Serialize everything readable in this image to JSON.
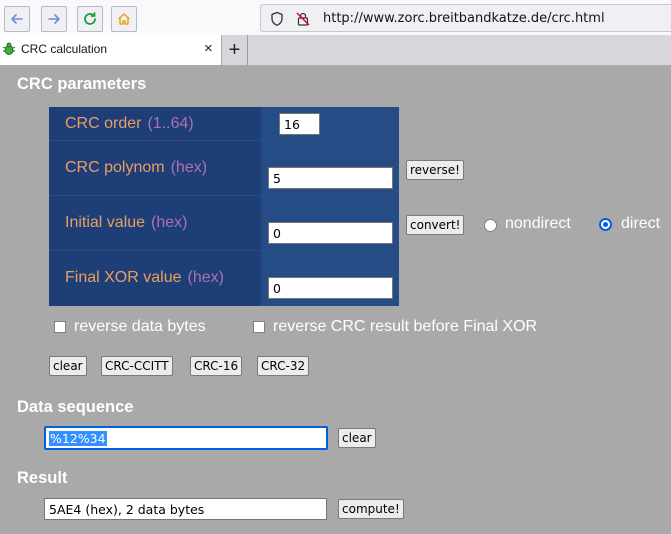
{
  "browser": {
    "url": "http://www.zorc.breitbandkatze.de/crc.html",
    "tab_title": "CRC calculation",
    "tab_close": "×",
    "new_tab": "+"
  },
  "params": {
    "heading": "CRC parameters",
    "rows": [
      {
        "label": "CRC order",
        "hint": "(1..64)",
        "value": "16"
      },
      {
        "label": "CRC polynom",
        "hint": "(hex)",
        "value": "5"
      },
      {
        "label": "Initial value",
        "hint": "(hex)",
        "value": "0"
      },
      {
        "label": "Final XOR value",
        "hint": "(hex)",
        "value": "0"
      }
    ],
    "reverse_button": "reverse!",
    "convert_button": "convert!",
    "radio_nondirect": "nondirect",
    "radio_direct": "direct",
    "selected_mode": "direct"
  },
  "options": {
    "reverse_data_bytes": "reverse data bytes",
    "reverse_crc_result": "reverse CRC result before Final XOR"
  },
  "presets": {
    "clear": "clear",
    "ccitt": "CRC-CCITT",
    "crc16": "CRC-16",
    "crc32": "CRC-32"
  },
  "data": {
    "heading": "Data sequence",
    "value": "%12%34",
    "clear": "clear"
  },
  "result": {
    "heading": "Result",
    "value": "5AE4 (hex), 2 data bytes",
    "compute": "compute!"
  },
  "colors": {
    "page_bg": "#a9a9a9",
    "table_label_bg": "#1e3e78",
    "table_input_bg": "#264c86",
    "label_text": "#e8a060",
    "hint_text": "#b070b0",
    "focus_accent": "#0060df"
  }
}
